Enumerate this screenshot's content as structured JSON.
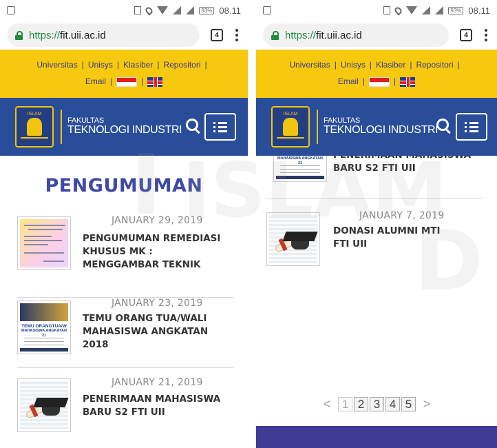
{
  "status_bar": {
    "time": "08.11",
    "time_right": "08.11",
    "battery": "93%"
  },
  "browser": {
    "url_scheme": "https://",
    "url_host": "fit.uii.ac.id",
    "tab_count": "4"
  },
  "top_links": [
    "Universitas",
    "Unisys",
    "Klasiber",
    "Repositori",
    "Email"
  ],
  "top_sep": "|",
  "header": {
    "faculty_line1": "FAKULTAS",
    "faculty_line2": "TEKNOLOGI INDUSTRI",
    "emblem_text": "ISLAM"
  },
  "page_title": "PENGUMUMAN",
  "posts": [
    {
      "date": "JANUARY 29, 2019",
      "title": "PENGUMUMAN REMEDIASI KHUSUS MK : MENGGAMBAR TEKNIK"
    },
    {
      "date": "JANUARY 23, 2019",
      "title": "TEMU ORANG TUA/WALI MAHASISWA ANGKATAN 2018"
    },
    {
      "date": "JANUARY 21, 2019",
      "title": "PENERIMAAN MAHASISWA BARU S2 FTI UII"
    },
    {
      "date": "JANUARY 7, 2019",
      "title": "DONASI ALUMNI MTI FTI UII"
    }
  ],
  "right_partial_title_top": "PENERIMAAN MAHASISWA",
  "right_partial_title_bottom": "BARU S2 FTI UII",
  "poster_text": {
    "line1": "TEMU ORANGTUA/W",
    "line2": "MAHASISWA ANGKATAN 21"
  },
  "pagination": {
    "prev": "<",
    "next": ">",
    "pages": [
      "1",
      "2",
      "3",
      "4",
      "5"
    ],
    "current": "1"
  },
  "watermark": "ISLAM",
  "colors": {
    "yellow": "#f6c90e",
    "navy": "#2a4d9a",
    "title_blue": "#3f4aa5",
    "footer": "#3d3b94"
  }
}
